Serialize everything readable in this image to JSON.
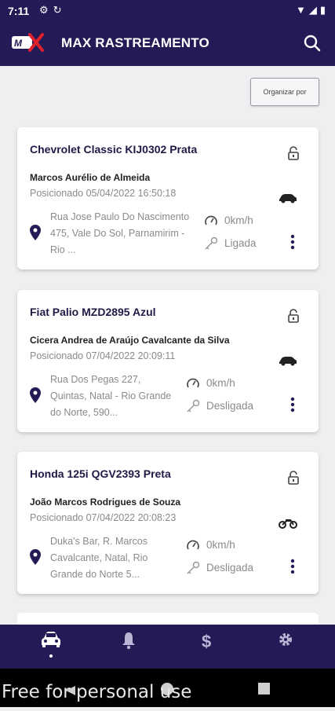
{
  "status_bar": {
    "time": "7:11",
    "left_icons": [
      "gear-icon",
      "sync-icon"
    ],
    "right_icons": [
      "wifi-icon",
      "signal-icon",
      "battery-icon"
    ]
  },
  "app_bar": {
    "logo_text": "MX",
    "title": "MAX RASTREAMENTO",
    "search_icon": "search-icon"
  },
  "toolbar": {
    "sort_label": "Organizar por"
  },
  "vehicles": [
    {
      "title": "Chevrolet Classic KIJ0302 Prata",
      "driver": "Marcos Aurélio de Almeida",
      "positioned": "Posicionado 05/04/2022 16:50:18",
      "address": "Rua Jose Paulo Do Nascimento 475, Vale Do Sol, Parnamirim - Rio ...",
      "speed": "0km/h",
      "ignition": "Ligada",
      "type_icon": "car-icon"
    },
    {
      "title": "Fiat Palio MZD2895 Azul",
      "driver": "Cicera Andrea de Araújo Cavalcante da Silva",
      "positioned": "Posicionado 07/04/2022 20:09:11",
      "address": "Rua Dos Pegas 227, Quintas, Natal - Rio Grande do Norte, 590...",
      "speed": "0km/h",
      "ignition": "Desligada",
      "type_icon": "car-icon"
    },
    {
      "title": "Honda 125i QGV2393 Preta",
      "driver": "João Marcos Rodrigues de Souza",
      "positioned": "Posicionado 07/04/2022 20:08:23",
      "address": "Duka's Bar, R. Marcos Cavalcante, Natal, Rio Grande do Norte 5...",
      "speed": "0km/h",
      "ignition": "Desligada",
      "type_icon": "motorcycle-icon"
    }
  ],
  "bottom_nav": {
    "items": [
      "car-icon",
      "bell-icon",
      "dollar-icon",
      "settings-icon"
    ],
    "active": "car-icon"
  },
  "watermark": "Free for personal use",
  "colors": {
    "primary": "#231b55",
    "accent": "#e0202c",
    "muted_text": "#8a8a8a"
  }
}
